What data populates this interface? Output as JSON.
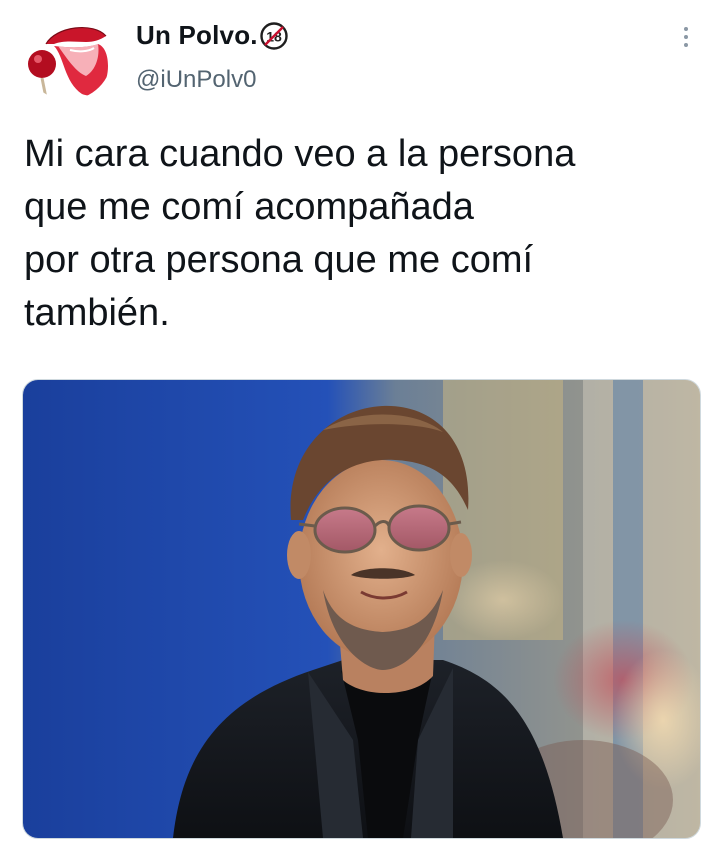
{
  "user": {
    "display_name": "Un Polvo.",
    "badge": "18",
    "handle": "@iUnPolv0"
  },
  "tweet": {
    "text_lines": [
      "Mi cara cuando veo a la persona",
      "que me comí acompañada",
      "por otra persona que me comí",
      "también."
    ]
  },
  "icons": {
    "avatar": "lips-lollipop-icon",
    "more": "more-vertical-icon",
    "badge": "adult-18-icon"
  },
  "colors": {
    "text": "#0f1419",
    "secondary": "#536471",
    "photo_background_blue": "#1c44a8"
  }
}
